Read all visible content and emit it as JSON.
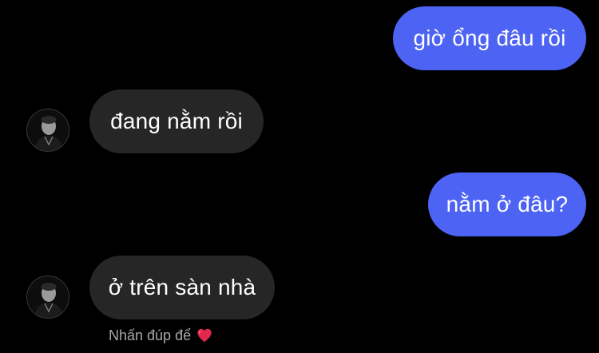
{
  "messages": [
    {
      "direction": "outgoing",
      "text": "giờ ổng đâu rồi"
    },
    {
      "direction": "incoming",
      "text": "đang nằm rồi",
      "avatar_icon": "profile-avatar"
    },
    {
      "direction": "outgoing",
      "text": "nằm ở đâu?"
    },
    {
      "direction": "incoming",
      "text": "ở trên sàn nhà",
      "avatar_icon": "profile-avatar"
    }
  ],
  "hint": {
    "text": "Nhấn đúp để",
    "icon": "heart-icon"
  },
  "colors": {
    "background": "#000000",
    "outgoing_bubble": "#4d63f3",
    "incoming_bubble": "#262626",
    "hint_text": "#a8a8a8",
    "heart": "#e0284a"
  }
}
